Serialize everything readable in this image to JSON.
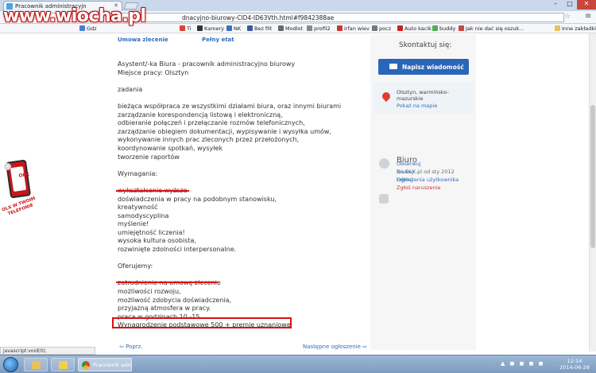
{
  "browser": {
    "tab_title": "Pracownik administracyjn",
    "url_visible": "dnacyjno-biurowy-CID4-ID63Vth.html#f9842388ae",
    "bookmarks": [
      "Gdz",
      "Ti",
      "Kamery",
      "NK",
      "Bez filt",
      "Modlot",
      "profil2",
      "irfan wiev",
      "pocz",
      "Auto kacik",
      "buddy",
      "Jak nie dać się oszuk...",
      "Inne zakładki"
    ]
  },
  "watermark": "www.wiocha.pl",
  "job": {
    "contract_types": [
      "Umowa zlecenie",
      "Pełny etat"
    ],
    "title_line": "Asystent/-ka Biura - pracownik administracyjno biurowy",
    "location_line": "Miejsce pracy: Olsztyn",
    "tasks_heading": "zadania",
    "tasks": [
      "bieżąca współpraca ze wszystkimi działami biura, oraz innymi biurami",
      "zarządzanie korespondencją listową i elektroniczną,",
      "odbieranie połączeń i przełączanie rozmów telefonicznych,",
      "zarządzanie obiegiem dokumentacji, wypisywanie i wysyłka umów,",
      "wykonywanie innych prac zleconych przez przełożonych,",
      "koordynowanie spotkań, wysyłek",
      "tworzenie raportów"
    ],
    "requirements_heading": "Wymagania:",
    "requirements": [
      "wykształcenie wyższe",
      "doświadczenia w pracy na podobnym stanowisku,",
      "kreatywność",
      "samodyscyplina",
      "myślenie!",
      "umiejętność liczenia!",
      "wysoka kultura osobista,",
      "rozwinięte zdolności interpersonalne."
    ],
    "offer_heading": "Oferujemy:",
    "offer": [
      "zatrudnienie na umowę zlecenie",
      "możliwości rozwoju,",
      "możliwość zdobycia doświadczenia,",
      "przyjazną atmosfera w pracy.",
      "praca w godzinach 10 -15",
      "Wynagrodzenie podstawowe 500 + premie uznaniowe"
    ],
    "prev_label": "Poprz.",
    "next_label": "Następne ogłoszenie"
  },
  "sidebar": {
    "contact_title": "Skontaktuj się:",
    "message_button": "Napisz wiadomość",
    "location": "Olsztyn, warmińsko-mazurskie",
    "map_link": "Pokaż na mapie",
    "user_name": "Biuro",
    "user_since": "Na OLX.pl od sty 2012",
    "user_ads": "Ogłoszenia użytkownika",
    "actions": [
      "Obserwuj",
      "Drukuj",
      "Edytuj",
      "Zgłoś naruszenie"
    ]
  },
  "ad": {
    "brand": "OLX",
    "slogan": "OLX W TWOIM TELEFONIE"
  },
  "status_text": "javascript:void(0);",
  "taskbar": {
    "chrome_task": "Pracownik admini...",
    "time": "12:14",
    "date": "2014-06-28"
  }
}
